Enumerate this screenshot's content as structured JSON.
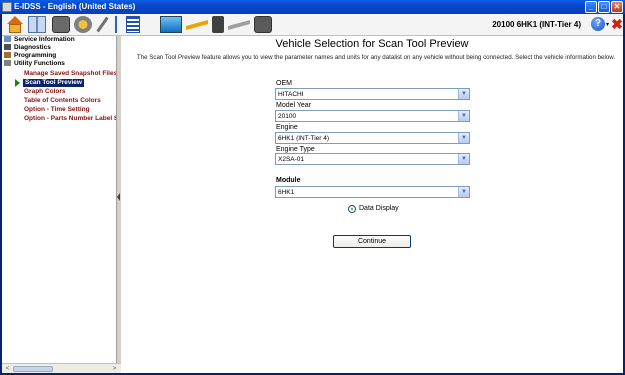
{
  "window": {
    "title": "E-IDSS - English (United States)",
    "minimize": "_",
    "maximize": "□",
    "close": "✕"
  },
  "toolbar": {
    "vehicle_label": "20100 6HK1 (INT-Tier 4)",
    "help_glyph": "?",
    "help_caret": "▾",
    "exit_glyph": "✖",
    "icons": [
      "home-icon",
      "book-icon",
      "engine-icon",
      "gear-icon",
      "wrench-icon",
      "plug-icon",
      "list-icon",
      "screen-icon",
      "flash-icon",
      "device-icon",
      "flash2-icon",
      "engine2-icon"
    ]
  },
  "sidebar": {
    "items": [
      {
        "label": "Service Information"
      },
      {
        "label": "Diagnostics"
      },
      {
        "label": "Programming"
      },
      {
        "label": "Utility Functions"
      }
    ],
    "subitems": [
      {
        "label": "Manage Saved Snapshot Files"
      },
      {
        "label": "Scan Tool Preview",
        "selected": true
      },
      {
        "label": "Graph Colors"
      },
      {
        "label": "Table of Contents Colors"
      },
      {
        "label": "Option - Time Setting"
      },
      {
        "label": "Option - Parts Number Label Setting"
      }
    ]
  },
  "main": {
    "title": "Vehicle Selection for Scan Tool Preview",
    "description": "The Scan Tool Preview feature allows you to view the parameter names and units for any datalist on any vehicle without being connected.  Select the vehicle information below.",
    "fields": {
      "oem": {
        "label": "OEM",
        "value": "HITACHI"
      },
      "model_year": {
        "label": "Model Year",
        "value": "20100"
      },
      "engine": {
        "label": "Engine",
        "value": "6HK1 (INT-Tier 4)"
      },
      "engine_type": {
        "label": "Engine Type",
        "value": "X2SA-01"
      },
      "module": {
        "label": "Module",
        "value": "6HK1"
      }
    },
    "radio_label": "Data Display",
    "continue_label": "Continue"
  },
  "colors": {
    "titlebar": "#0a5ee8",
    "selected_bg": "#0a246a",
    "sub_item_text": "#8b1010"
  }
}
